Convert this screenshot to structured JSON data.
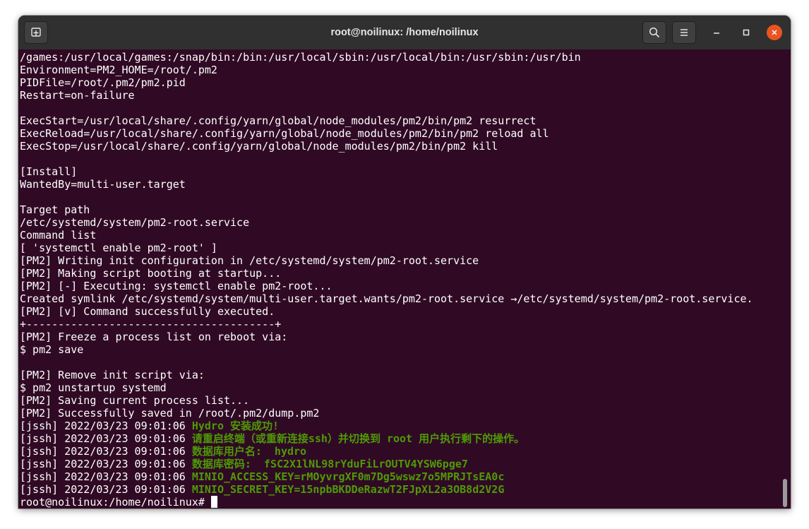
{
  "window": {
    "title": "root@noilinux: /home/noilinux"
  },
  "titlebar": {
    "new_tab_icon": "new-tab-icon",
    "search_icon": "search-icon",
    "menu_icon": "hamburger-menu-icon",
    "minimize_icon": "minimize-icon",
    "maximize_icon": "maximize-icon",
    "close_icon": "close-icon",
    "close_color": "#e95420"
  },
  "colors": {
    "terminal_background": "#300a24",
    "titlebar_background": "#303030",
    "text": "#ffffff",
    "green_text": "#4e9a06"
  },
  "terminal": {
    "lines": [
      {
        "text": "/games:/usr/local/games:/snap/bin:/bin:/usr/local/sbin:/usr/local/bin:/usr/sbin:/usr/bin"
      },
      {
        "text": "Environment=PM2_HOME=/root/.pm2"
      },
      {
        "text": "PIDFile=/root/.pm2/pm2.pid"
      },
      {
        "text": "Restart=on-failure"
      },
      {
        "text": ""
      },
      {
        "text": "ExecStart=/usr/local/share/.config/yarn/global/node_modules/pm2/bin/pm2 resurrect"
      },
      {
        "text": "ExecReload=/usr/local/share/.config/yarn/global/node_modules/pm2/bin/pm2 reload all"
      },
      {
        "text": "ExecStop=/usr/local/share/.config/yarn/global/node_modules/pm2/bin/pm2 kill"
      },
      {
        "text": ""
      },
      {
        "text": "[Install]"
      },
      {
        "text": "WantedBy=multi-user.target"
      },
      {
        "text": ""
      },
      {
        "text": "Target path"
      },
      {
        "text": "/etc/systemd/system/pm2-root.service"
      },
      {
        "text": "Command list"
      },
      {
        "text": "[ 'systemctl enable pm2-root' ]"
      },
      {
        "text": "[PM2] Writing init configuration in /etc/systemd/system/pm2-root.service"
      },
      {
        "text": "[PM2] Making script booting at startup..."
      },
      {
        "text": "[PM2] [-] Executing: systemctl enable pm2-root..."
      },
      {
        "text": "Created symlink /etc/systemd/system/multi-user.target.wants/pm2-root.service →/etc/systemd/system/pm2-root.service."
      },
      {
        "text": "[PM2] [v] Command successfully executed."
      },
      {
        "text": "+---------------------------------------+"
      },
      {
        "text": "[PM2] Freeze a process list on reboot via:"
      },
      {
        "text": "$ pm2 save"
      },
      {
        "text": ""
      },
      {
        "text": "[PM2] Remove init script via:"
      },
      {
        "text": "$ pm2 unstartup systemd"
      },
      {
        "text": "[PM2] Saving current process list..."
      },
      {
        "text": "[PM2] Successfully saved in /root/.pm2/dump.pm2"
      },
      {
        "text": "[jssh] 2022/03/23 09:01:06 ",
        "green": "Hydro 安装成功!"
      },
      {
        "text": "[jssh] 2022/03/23 09:01:06 ",
        "green": "请重启终端（或重新连接ssh）并切换到 root 用户执行剩下的操作。"
      },
      {
        "text": "[jssh] 2022/03/23 09:01:06 ",
        "green": "数据库用户名:  hydro"
      },
      {
        "text": "[jssh] 2022/03/23 09:01:06 ",
        "green": "数据库密码:  fSC2X1lNL98rYduFiLrOUTV4YSW6pge7"
      },
      {
        "text": "[jssh] 2022/03/23 09:01:06 ",
        "green": "MINIO_ACCESS_KEY=rMOyvrgXF0m7Dg5wswz7o5MPRJTsEA0c"
      },
      {
        "text": "[jssh] 2022/03/23 09:01:06 ",
        "green": "MINIO_SECRET_KEY=15npbBKDDeRazwT2FJpXL2a3OB8d2V2G"
      }
    ],
    "prompt": "root@noilinux:/home/noilinux# "
  }
}
